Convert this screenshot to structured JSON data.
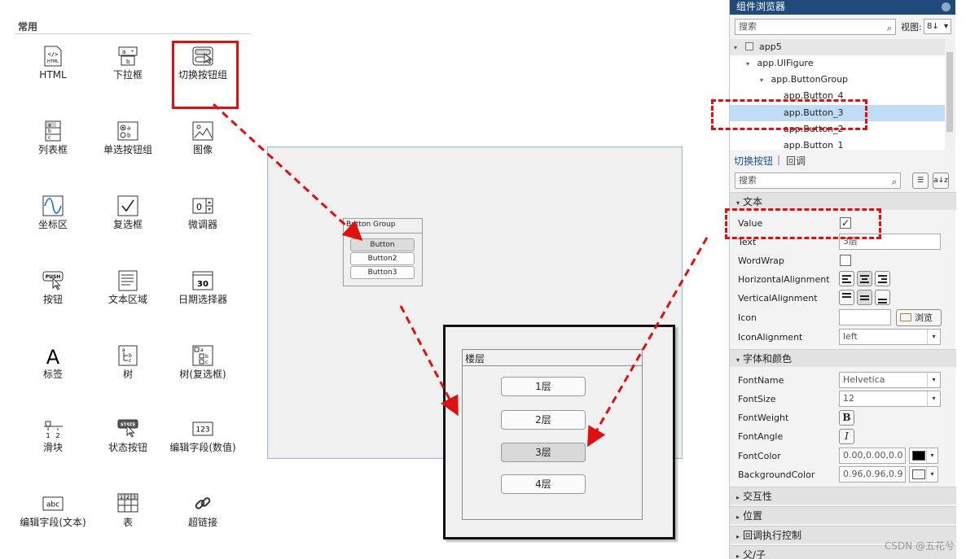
{
  "library": {
    "title": "常用",
    "components": [
      {
        "label": "HTML",
        "icon": "html-icon"
      },
      {
        "label": "下拉框",
        "icon": "dropdown-icon"
      },
      {
        "label": "切换按钮组",
        "icon": "toggle-button-group-icon"
      },
      {
        "label": "列表框",
        "icon": "listbox-icon"
      },
      {
        "label": "单选按钮组",
        "icon": "radio-group-icon"
      },
      {
        "label": "图像",
        "icon": "image-icon"
      },
      {
        "label": "坐标区",
        "icon": "axes-icon"
      },
      {
        "label": "复选框",
        "icon": "checkbox-icon"
      },
      {
        "label": "微调器",
        "icon": "spinner-icon"
      },
      {
        "label": "按钮",
        "icon": "push-button-icon"
      },
      {
        "label": "文本区域",
        "icon": "text-area-icon"
      },
      {
        "label": "日期选择器",
        "icon": "date-picker-icon"
      },
      {
        "label": "标签",
        "icon": "label-icon"
      },
      {
        "label": "树",
        "icon": "tree-icon"
      },
      {
        "label": "树(复选框)",
        "icon": "checkbox-tree-icon"
      },
      {
        "label": "滑块",
        "icon": "slider-icon"
      },
      {
        "label": "状态按钮",
        "icon": "state-button-icon"
      },
      {
        "label": "编辑字段(数值)",
        "icon": "numeric-field-icon"
      },
      {
        "label": "编辑字段(文本)",
        "icon": "text-field-icon"
      },
      {
        "label": "表",
        "icon": "table-icon"
      },
      {
        "label": "超链接",
        "icon": "hyperlink-icon"
      }
    ],
    "icon_text": {
      "html": "</>",
      "html_sub": "HTML",
      "dropdown_a": "a",
      "dropdown_b": "b",
      "list_a": "a",
      "list_b": "b",
      "list_c": "c",
      "radio_a": "a",
      "radio_b": "b",
      "spinner": "0",
      "push": "PUSH",
      "date": "30",
      "label": "A",
      "tree_a": "a",
      "tree_b": "b",
      "tree_c": "c",
      "slider_1": "1",
      "slider_2": "2",
      "state": "STATE",
      "numeric": "123",
      "text_field": "abc",
      "table_1": "1",
      "table_2": "2",
      "table_3": "3"
    }
  },
  "canvas": {
    "group_title": "Button Group",
    "buttons": [
      "Button",
      "Button2",
      "Button3"
    ]
  },
  "preview": {
    "group_title": "楼层",
    "buttons": [
      "1层",
      "2层",
      "3层",
      "4层"
    ]
  },
  "browser": {
    "title": "组件浏览器",
    "search_placeholder": "搜索",
    "view_label": "视图:",
    "view_value": "8↓",
    "tree": [
      {
        "label": "app5",
        "level": 0,
        "expand": "▾"
      },
      {
        "label": "app.UIFigure",
        "level": 1,
        "expand": "▾"
      },
      {
        "label": "app.ButtonGroup",
        "level": 2,
        "expand": "▾"
      },
      {
        "label": "app.Button_4",
        "level": 3
      },
      {
        "label": "app.Button_3",
        "level": 3
      },
      {
        "label": "app.Button_2",
        "level": 3
      },
      {
        "label": "app.Button_1",
        "level": 3
      }
    ],
    "tabs": {
      "active": "切换按钮",
      "sep": "|",
      "other": "回调"
    },
    "prop_search_placeholder": "搜索",
    "sort_icon_text": "a↓z",
    "sections": {
      "text": "文本",
      "font": "字体和颜色",
      "interactivity": "交互性",
      "position": "位置",
      "callback": "回调执行控制",
      "parent": "父/子"
    },
    "props": {
      "value_label": "Value",
      "value_check": "✓",
      "text_label": "Text",
      "text_value": "3层",
      "wordwrap_label": "WordWrap",
      "halign_label": "HorizontalAlignment",
      "valign_label": "VerticalAlignment",
      "icon_label": "Icon",
      "browse_label": "浏览",
      "iconalign_label": "IconAlignment",
      "iconalign_value": "left",
      "fontname_label": "FontName",
      "fontname_value": "Helvetica",
      "fontsize_label": "FontSize",
      "fontsize_value": "12",
      "fontweight_label": "FontWeight",
      "bold_glyph": "B",
      "fontangle_label": "FontAngle",
      "italic_glyph": "I",
      "fontcolor_label": "FontColor",
      "fontcolor_value": "0.00,0.00,0.0",
      "bgcolor_label": "BackgroundColor",
      "bgcolor_value": "0.96,0.96,0.9"
    },
    "dropdown_glyph": "▾",
    "collapsed_glyph": "▸"
  },
  "watermark": "CSDN @五花兮",
  "colors": {
    "highlight": "#e01010",
    "header_blue": "#1f4a7a",
    "selection": "#c1dcf6",
    "font_color": "#000000",
    "bg_color": "#f5f5f5"
  }
}
